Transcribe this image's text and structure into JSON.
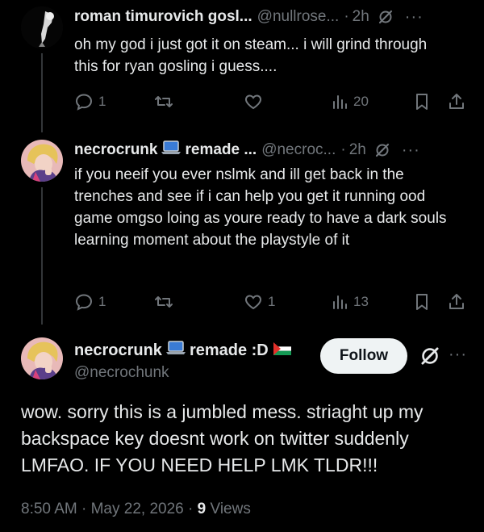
{
  "colors": {
    "background": "#000000",
    "text": "#e7e9ea",
    "muted": "#71767b",
    "follow_bg": "#eff3f4"
  },
  "tweets": [
    {
      "name": "roman timurovich gosl...",
      "handle": "@nullrose...",
      "separator": "·",
      "time": "2h",
      "more": "···",
      "text": "oh my god i just got it on steam... i will grind through this for ryan gosling i guess....",
      "replies": "1",
      "reposts": "",
      "likes": "",
      "views": "20"
    },
    {
      "name_part1": "necrocrunk",
      "name_part2": "remade ...",
      "handle": "@necroc...",
      "separator": "·",
      "time": "2h",
      "more": "···",
      "text": "if you neeif you ever nslmk and ill get back in the trenches and see if i can help you get it running ood game omgso loing as youre ready to have a dark souls learning moment about the playstyle of it",
      "replies": "1",
      "reposts": "",
      "likes": "1",
      "views": "13"
    }
  ],
  "focus": {
    "name_part1": "necrocrunk",
    "name_part2": "remade :D",
    "handle": "@necrochunk",
    "follow_label": "Follow",
    "more": "···",
    "text": "wow. sorry this is a jumbled mess. striaght up my backspace key doesnt work on twitter suddenly LMFAO. IF YOU NEED HELP LMK TLDR!!!",
    "time": "8:50 AM",
    "separator": "·",
    "date": "May 22, 2026",
    "views_count": "9",
    "views_label": "Views"
  },
  "icons": [
    "reply-icon",
    "repost-icon",
    "like-icon",
    "views-icon",
    "bookmark-icon",
    "share-icon",
    "grok-icon",
    "laptop-emoji-icon",
    "palestine-flag-icon"
  ]
}
